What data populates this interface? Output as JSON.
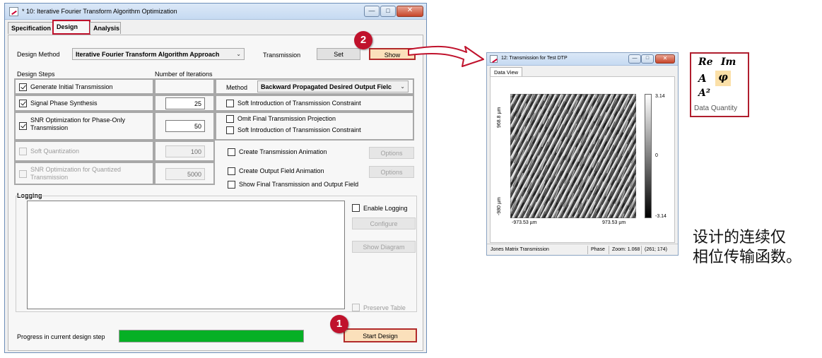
{
  "main_window": {
    "title": "* 10: Iterative Fourier Transform Algorithm Optimization",
    "tabs": [
      "Specification",
      "Design",
      "Analysis"
    ],
    "design_method_label": "Design Method",
    "design_method_value": "Iterative Fourier Transform Algorithm Approach",
    "transmission_label": "Transmission",
    "set_label": "Set",
    "show_label": "Show",
    "design_steps_label": "Design Steps",
    "iterations_label": "Number of Iterations",
    "method_label": "Method",
    "method_value": "Backward Propagated Desired Output Fielc",
    "steps": [
      {
        "label": "Generate Initial Transmission",
        "checked": true,
        "enabled": true,
        "iterations": ""
      },
      {
        "label": "Signal Phase Synthesis",
        "checked": true,
        "enabled": true,
        "iterations": "25"
      },
      {
        "label": "SNR Optimization for Phase-Only Transmission",
        "checked": true,
        "enabled": true,
        "iterations": "50"
      },
      {
        "label": "Soft Quantization",
        "checked": false,
        "enabled": false,
        "iterations": "100"
      },
      {
        "label": "SNR Optimization for Quantized Transmission",
        "checked": false,
        "enabled": false,
        "iterations": "5000"
      }
    ],
    "options": {
      "soft_intro_1": "Soft Introduction of Transmission Constraint",
      "omit_final": "Omit Final Transmission Projection",
      "soft_intro_2": "Soft Introduction of Transmission Constraint",
      "create_trans_anim": "Create Transmission Animation",
      "create_output_anim": "Create Output Field Animation",
      "show_final": "Show Final Transmission and Output Field",
      "options_label": "Options"
    },
    "logging": {
      "label": "Logging",
      "enable_logging": "Enable Logging",
      "configure": "Configure",
      "show_diagram": "Show Diagram",
      "preserve_table": "Preserve Table"
    },
    "progress_label": "Progress in current design step",
    "progress_value": 1.0,
    "start_design": "Start Design"
  },
  "badges": {
    "one": "1",
    "two": "2"
  },
  "view_window": {
    "title": "12: Transmission for Test DTP",
    "tab": "Data View",
    "y_top": "968.8 µm",
    "y_bottom": "-980 µm",
    "x_left": "-973.53 µm",
    "x_right": "973.53 µm",
    "cb_max": "3.14",
    "cb_mid": "0",
    "cb_min": "-3.14",
    "status_left": "Jones Matrix Transmission",
    "status_phase": "Phase",
    "status_zoom": "Zoom: 1.068",
    "status_coords": "(261; 174)"
  },
  "data_quantity": {
    "re": "Re",
    "im": "Im",
    "amp": "A",
    "phase": "φ",
    "amp2": "A²",
    "label": "Data Quantity"
  },
  "annotation": {
    "line1": "设计的连续仅",
    "line2": "相位传输函数。"
  },
  "colors": {
    "accent_red": "#c0122c",
    "progress_green": "#06b025",
    "highlight": "#fbe0bb"
  }
}
